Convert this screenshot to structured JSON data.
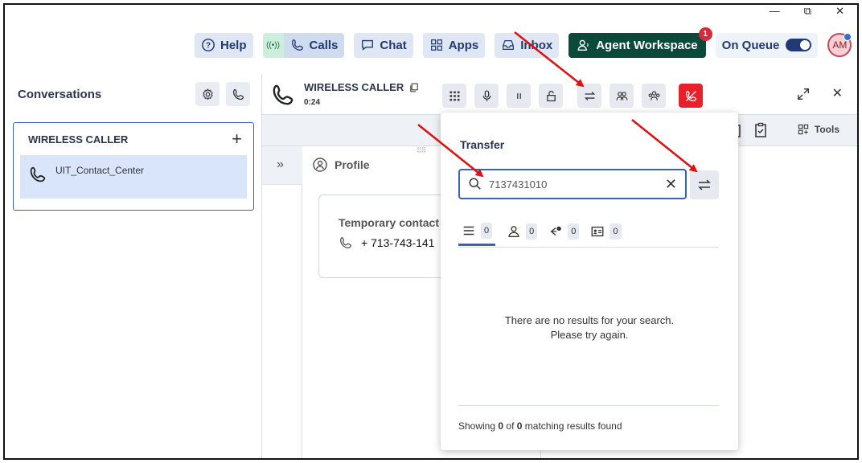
{
  "window": {
    "minimize": "—",
    "restore": "⧉",
    "close": "✕"
  },
  "topnav": {
    "help": "Help",
    "calls": "Calls",
    "calls_live": "((•))",
    "chat": "Chat",
    "apps": "Apps",
    "inbox": "Inbox",
    "agent_workspace": "Agent Workspace",
    "agent_badge": "1",
    "on_queue": "On Queue",
    "avatar": "AM"
  },
  "sidebar": {
    "title": "Conversations",
    "conversation": {
      "name": "WIRELESS CALLER",
      "add": "+",
      "item_label": "UIT_Contact_Center"
    }
  },
  "call": {
    "caller_name": "WIRELESS CALLER",
    "duration": "0:24",
    "close": "✕"
  },
  "subbar": {
    "tools": "Tools"
  },
  "profile": {
    "collapse": "»",
    "header": "Profile",
    "drag_handle": "⠿⠿",
    "contact_title": "Temporary contact",
    "contact_phone": "+ 713-743-141"
  },
  "transfer": {
    "title": "Transfer",
    "search_value": "7137431010",
    "clear": "✕",
    "filters": [
      {
        "name": "all",
        "count": "0"
      },
      {
        "name": "people",
        "count": "0"
      },
      {
        "name": "queues",
        "count": "0"
      },
      {
        "name": "external",
        "count": "0"
      }
    ],
    "empty_line1": "There are no results for your search.",
    "empty_line2": "Please try again.",
    "footer_prefix": "Showing ",
    "footer_shown": "0",
    "footer_of": " of ",
    "footer_total": "0",
    "footer_suffix": " matching results found"
  },
  "colors": {
    "accent": "#3a63b5",
    "agent_workspace_bg": "#0b4a3a",
    "disconnect": "#e8202a",
    "annotation_arrow": "#e01010"
  }
}
